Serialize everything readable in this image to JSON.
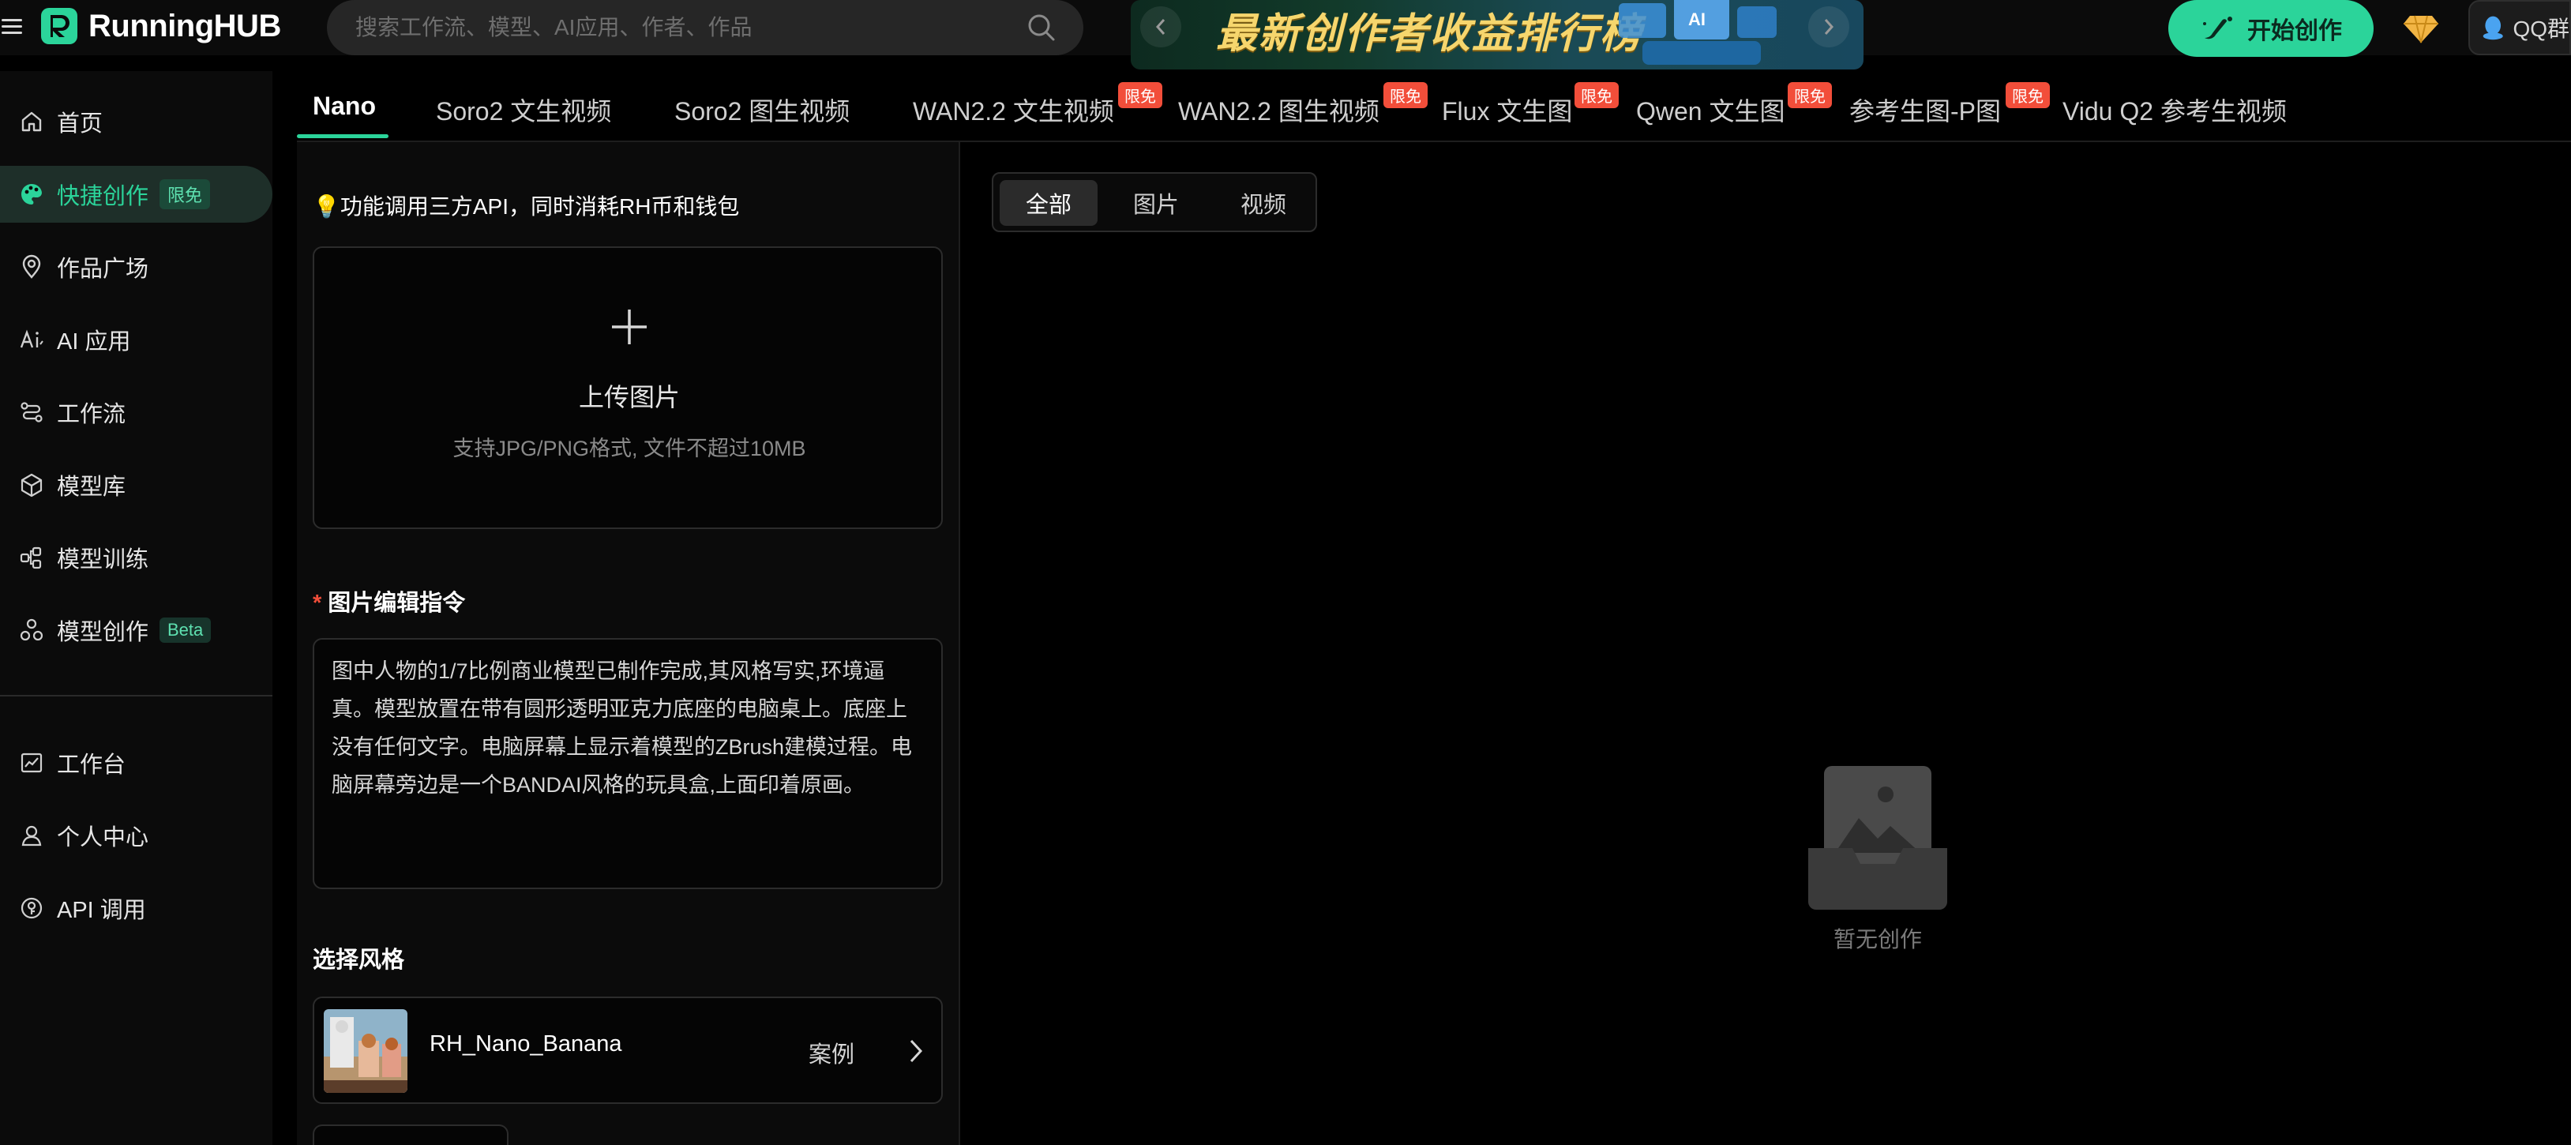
{
  "header": {
    "brand": "RunningHUB",
    "search_placeholder": "搜索工作流、模型、AI应用、作者、作品",
    "banner_title": "最新创作者收益排行榜",
    "start_label": "开始创作",
    "qq_label": "QQ群"
  },
  "sidebar": {
    "items": [
      {
        "label": "首页",
        "icon": "home-icon"
      },
      {
        "label": "快捷创作",
        "icon": "palette-icon",
        "badge": "限免",
        "active": true
      },
      {
        "label": "作品广场",
        "icon": "location-pin-icon"
      },
      {
        "label": "AI 应用",
        "icon": "ai-app-icon"
      },
      {
        "label": "工作流",
        "icon": "workflow-icon"
      },
      {
        "label": "模型库",
        "icon": "cube-icon"
      },
      {
        "label": "模型训练",
        "icon": "training-icon"
      },
      {
        "label": "模型创作",
        "icon": "model-create-icon",
        "badge": "Beta"
      },
      {
        "label": "工作台",
        "icon": "dashboard-icon"
      },
      {
        "label": "个人中心",
        "icon": "user-icon"
      },
      {
        "label": "API 调用",
        "icon": "api-icon"
      }
    ]
  },
  "tabs": [
    {
      "label": "Nano",
      "active": true
    },
    {
      "label": "Soro2 文生视频"
    },
    {
      "label": "Soro2 图生视频"
    },
    {
      "label": "WAN2.2 文生视频",
      "tag": "限免"
    },
    {
      "label": "WAN2.2 图生视频",
      "tag": "限免"
    },
    {
      "label": "Flux 文生图",
      "tag": "限免"
    },
    {
      "label": "Qwen 文生图",
      "tag": "限免"
    },
    {
      "label": "参考生图-P图",
      "tag": "限免"
    },
    {
      "label": "Vidu Q2 参考生视频"
    }
  ],
  "form": {
    "notice": "💡功能调用三方API，同时消耗RH币和钱包",
    "upload_title": "上传图片",
    "upload_hint": "支持JPG/PNG格式, 文件不超过10MB",
    "required_mark": "*",
    "prompt_label": "图片编辑指令",
    "prompt_value": "图中人物的1/7比例商业模型已制作完成,其风格写实,环境逼真。模型放置在带有圆形透明亚克力底座的电脑桌上。底座上没有任何文字。电脑屏幕上显示着模型的ZBrush建模过程。电脑屏幕旁边是一个BANDAI风格的玩具盒,上面印着原画。",
    "style_label": "选择风格",
    "style_name": "RH_Nano_Banana",
    "style_case": "案例"
  },
  "results": {
    "filters": [
      "全部",
      "图片",
      "视频"
    ],
    "active_filter": "全部",
    "empty_text": "暂无创作"
  },
  "colors": {
    "accent": "#2bd49a",
    "free_tag": "#f24e3a",
    "background": "#000000"
  }
}
